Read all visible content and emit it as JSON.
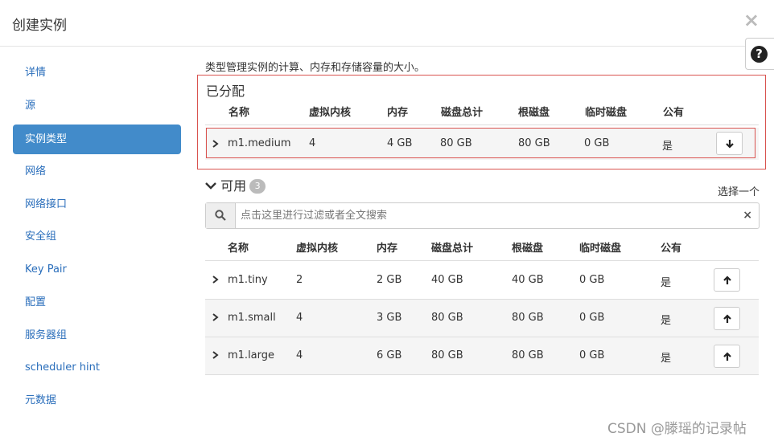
{
  "modal": {
    "title": "创建实例",
    "close_label": "×",
    "help_label": "?"
  },
  "sidebar": {
    "items": [
      {
        "label": "详情",
        "active": false
      },
      {
        "label": "源",
        "active": false
      },
      {
        "label": "实例类型",
        "active": true
      },
      {
        "label": "网络",
        "active": false
      },
      {
        "label": "网络接口",
        "active": false
      },
      {
        "label": "安全组",
        "active": false
      },
      {
        "label": "Key Pair",
        "active": false
      },
      {
        "label": "配置",
        "active": false
      },
      {
        "label": "服务器组",
        "active": false
      },
      {
        "label": "scheduler hint",
        "active": false
      },
      {
        "label": "元数据",
        "active": false
      }
    ]
  },
  "content": {
    "description": "类型管理实例的计算、内存和存储容量的大小。",
    "allocated": {
      "title": "已分配",
      "columns": [
        "名称",
        "虚拟内核",
        "内存",
        "磁盘总计",
        "根磁盘",
        "临时磁盘",
        "公有"
      ],
      "rows": [
        {
          "name": "m1.medium",
          "vcpus": "4",
          "ram": "4 GB",
          "disk_total": "80 GB",
          "root_disk": "80 GB",
          "ephemeral": "0 GB",
          "public": "是"
        }
      ]
    },
    "available": {
      "title": "可用",
      "count": "3",
      "select_hint": "选择一个",
      "search_placeholder": "点击这里进行过滤或者全文搜索",
      "clear_label": "×",
      "columns": [
        "名称",
        "虚拟内核",
        "内存",
        "磁盘总计",
        "根磁盘",
        "临时磁盘",
        "公有"
      ],
      "rows": [
        {
          "name": "m1.tiny",
          "vcpus": "2",
          "ram": "2 GB",
          "disk_total": "40 GB",
          "root_disk": "40 GB",
          "ephemeral": "0 GB",
          "public": "是"
        },
        {
          "name": "m1.small",
          "vcpus": "4",
          "ram": "3 GB",
          "disk_total": "80 GB",
          "root_disk": "80 GB",
          "ephemeral": "0 GB",
          "public": "是"
        },
        {
          "name": "m1.large",
          "vcpus": "4",
          "ram": "6 GB",
          "disk_total": "80 GB",
          "root_disk": "80 GB",
          "ephemeral": "0 GB",
          "public": "是"
        }
      ]
    }
  },
  "watermark": "CSDN @滕瑶的记录帖",
  "colors": {
    "accent": "#428bca",
    "link": "#2a6ebb",
    "highlight_border": "#d9534f"
  }
}
